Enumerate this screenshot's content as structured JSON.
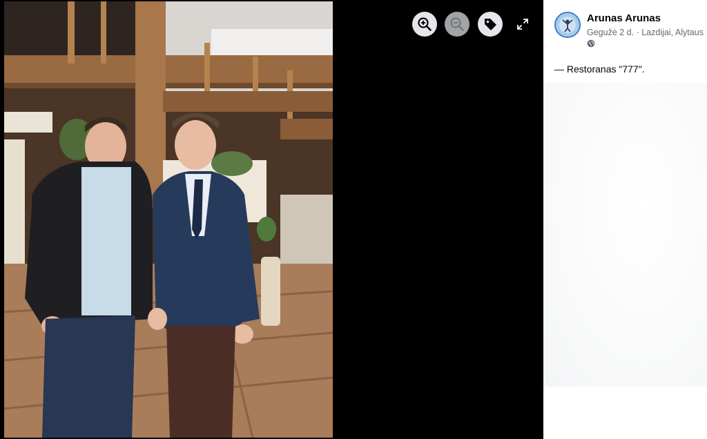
{
  "viewer": {
    "controls": [
      {
        "name": "zoom-in-button",
        "icon": "zoom-in-icon",
        "enabled": true
      },
      {
        "name": "zoom-out-button",
        "icon": "zoom-out-icon",
        "enabled": false
      },
      {
        "name": "tag-button",
        "icon": "tag-icon",
        "enabled": true
      }
    ],
    "expand_icon": "expand-icon"
  },
  "post": {
    "author": "Arunas Arunas",
    "date": "Gegužė 2 d.",
    "separator": " · ",
    "location": "Lazdijai, Alytaus",
    "privacy_icon": "globe-icon",
    "caption": "— Restoranas \"777\"."
  },
  "colors": {
    "viewer_bg": "#000000",
    "control_bg": "#e4e6eb",
    "text_primary": "#050505",
    "text_secondary": "#65676b"
  }
}
